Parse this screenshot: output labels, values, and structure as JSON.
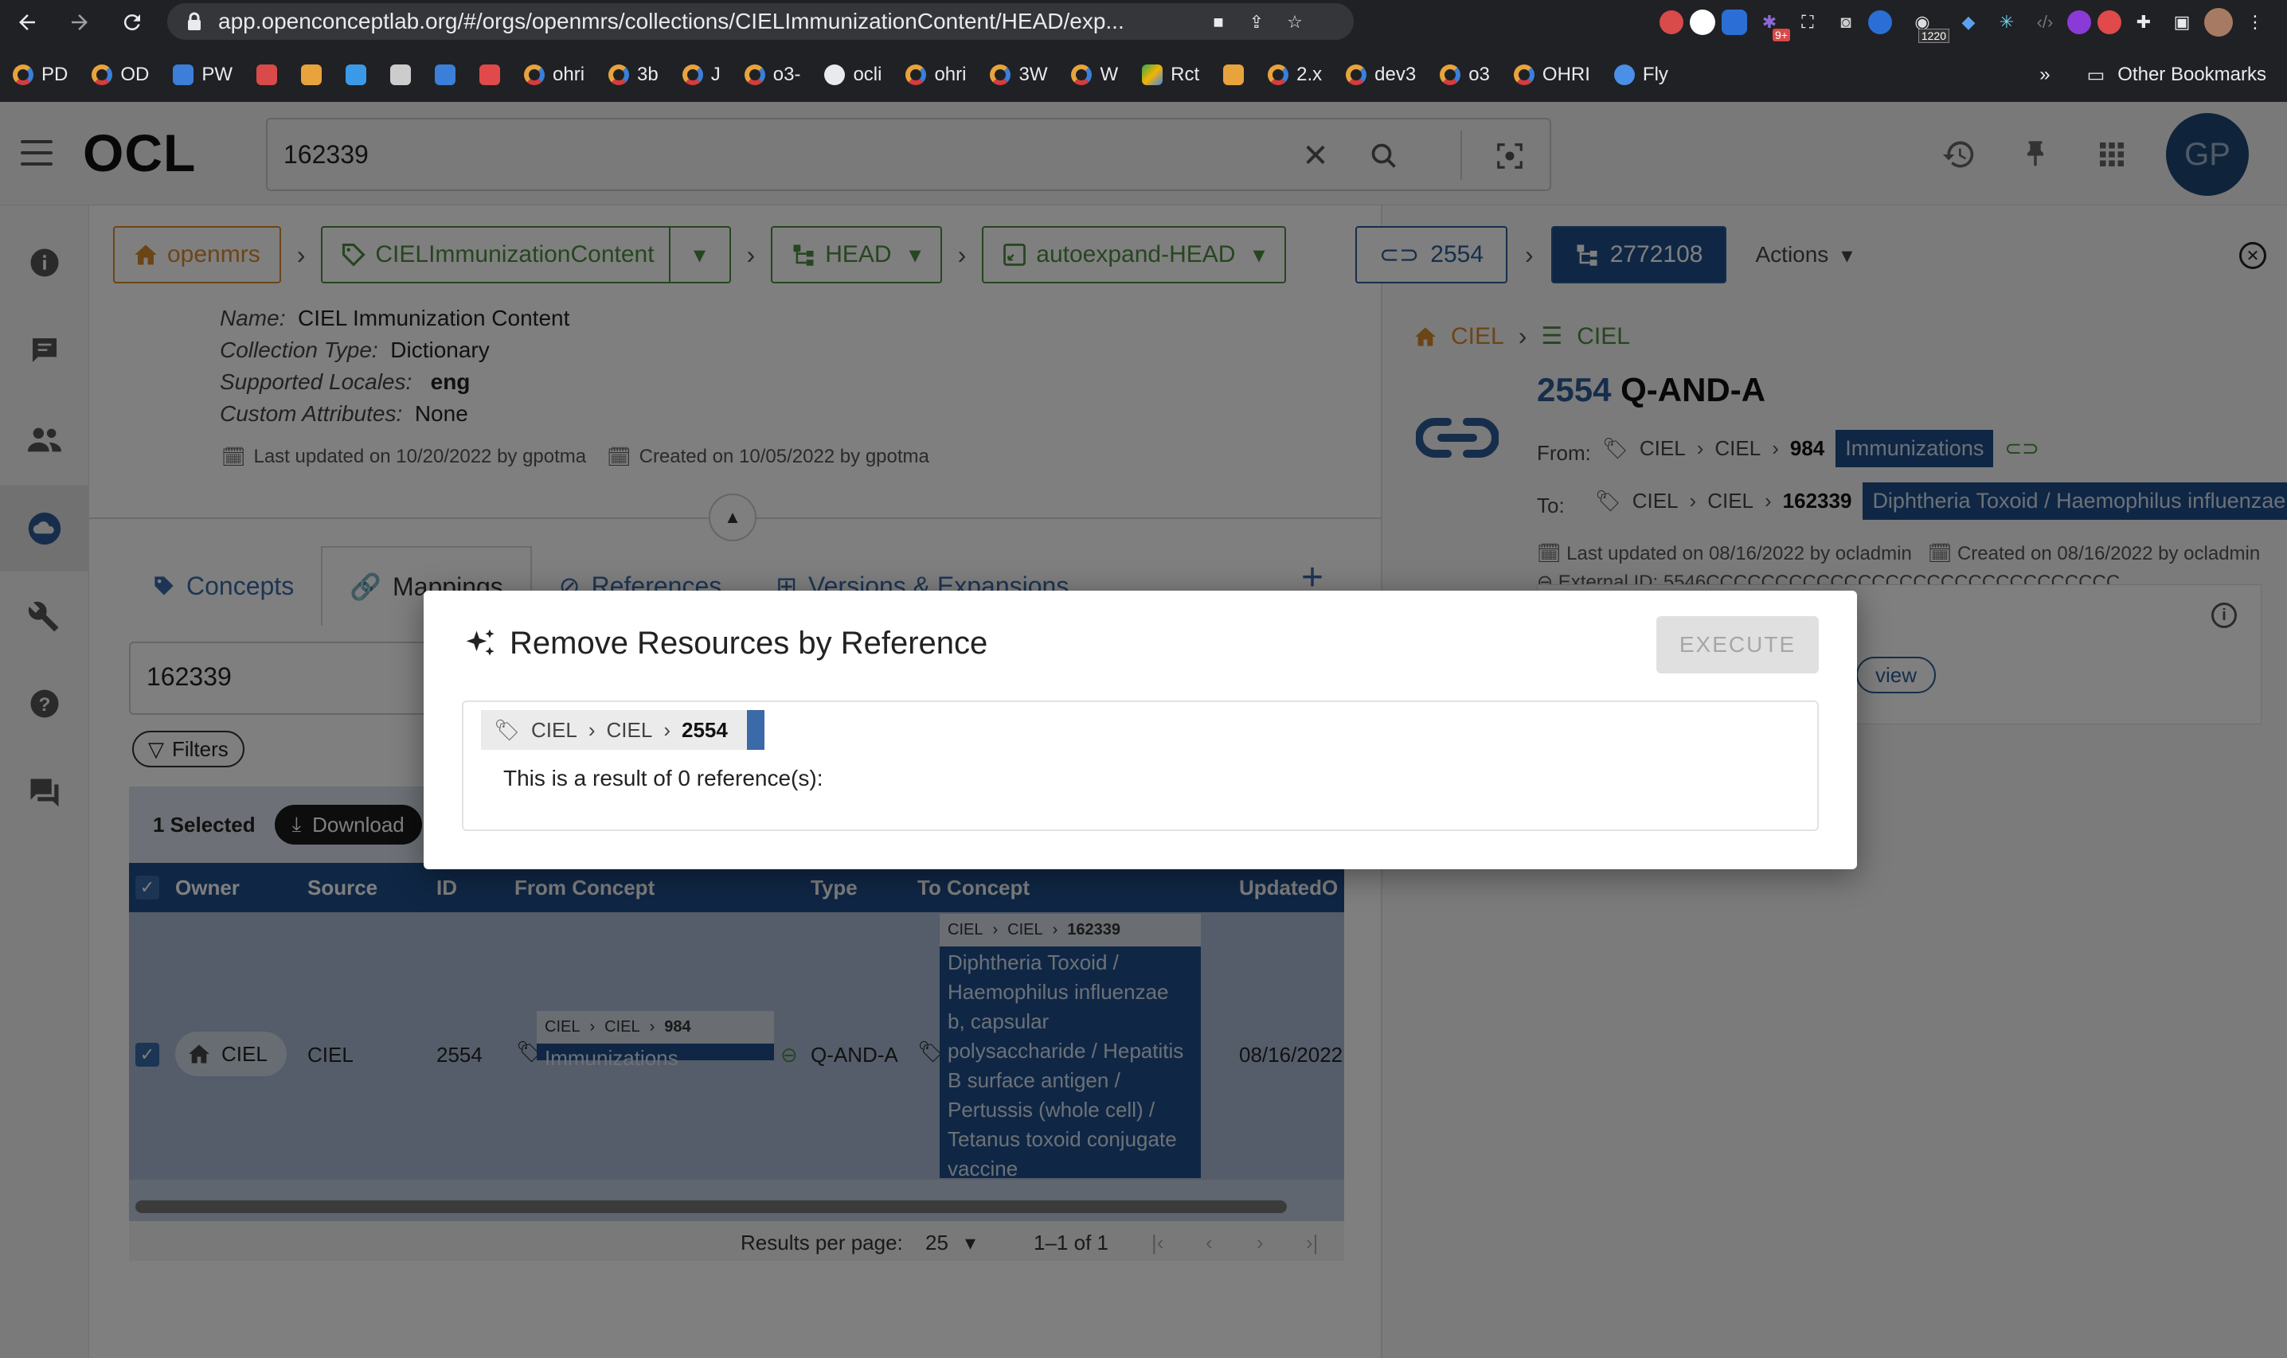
{
  "browser": {
    "url": "app.openconceptlab.org/#/orgs/openmrs/collections/CIELImmunizationContent/HEAD/exp...",
    "badge_count": "9+",
    "badge_number": "1220",
    "bookmarks": [
      "PD",
      "OD",
      "PW",
      "",
      "",
      "",
      "",
      "",
      "",
      "ohri",
      "3b",
      "J",
      "o3-",
      "ocli",
      "ohri",
      "3W",
      "W",
      "Rct",
      "",
      "2.x",
      "dev3",
      "o3",
      "OHRI",
      "Fly"
    ],
    "bookmarks_more": "»",
    "other_bookmarks": "Other Bookmarks"
  },
  "app": {
    "logo": "OCL",
    "search_value": "162339",
    "avatar_initials": "GP"
  },
  "breadcrumbs": {
    "org": "openmrs",
    "collection": "CIELImmunizationContent",
    "version": "HEAD",
    "expansion": "autoexpand-HEAD"
  },
  "collection_meta": {
    "name_label": "Name:",
    "name_value": "CIEL Immunization Content",
    "type_label": "Collection Type:",
    "type_value": "Dictionary",
    "locales_label": "Supported Locales:",
    "locales_value": "eng",
    "attrs_label": "Custom Attributes:",
    "attrs_value": "None",
    "last_updated": "Last updated on 10/20/2022 by gpotma",
    "created": "Created on 10/05/2022 by gpotma"
  },
  "tabs": [
    {
      "label": "Concepts"
    },
    {
      "label": "Mappings"
    },
    {
      "label": "References"
    },
    {
      "label": "Versions & Expansions"
    }
  ],
  "list": {
    "search_value": "162339",
    "filters_label": "Filters",
    "selected_label": "1 Selected",
    "download_label": "Download",
    "columns": [
      "Owner",
      "Source",
      "ID",
      "From Concept",
      "Type",
      "To Concept",
      "UpdatedO"
    ],
    "row": {
      "owner": "CIEL",
      "source": "CIEL",
      "id": "2554",
      "from_crumb": [
        "CIEL",
        "CIEL",
        "984"
      ],
      "from_name": "Immunizations",
      "type": "Q-AND-A",
      "to_crumb": [
        "CIEL",
        "CIEL",
        "162339"
      ],
      "to_name_lines": [
        "Diphtheria Toxoid /",
        "Haemophilus influenzae",
        "b, capsular",
        "polysaccharide / Hepatitis",
        "B surface antigen /",
        "Pertussis (whole cell) /",
        "Tetanus toxoid conjugate",
        "vaccine"
      ],
      "updated": "08/16/2022"
    },
    "pager": {
      "rows_label": "Results per page:",
      "rows_value": "25",
      "range": "1–1 of 1"
    }
  },
  "detail": {
    "mapping_chip": "2554",
    "version_chip": "2772108",
    "actions_label": "Actions",
    "crumb_owner": "CIEL",
    "crumb_source": "CIEL",
    "title_id": "2554",
    "title_type": "Q-AND-A",
    "from_label": "From:",
    "from_crumb": [
      "CIEL",
      "CIEL",
      "984"
    ],
    "from_name": "Immunizations",
    "to_label": "To:",
    "to_crumb": [
      "CIEL",
      "CIEL",
      "162339"
    ],
    "to_name": "Diphtheria Toxoid / Haemophilus influenzae",
    "last_updated": "Last updated on 08/16/2022 by ocladmin",
    "created": "Created on 08/16/2022 by ocladmin",
    "external_id": "External ID: 5546CCCCCCCCCCCCCCCCCCCCCCCCCCCCCC",
    "view_label": "view"
  },
  "dialog": {
    "title": "Remove Resources by Reference",
    "execute_label": "EXECUTE",
    "ref_crumb": [
      "CIEL",
      "CIEL",
      "2554"
    ],
    "result_text": "This is a result of 0 reference(s):"
  },
  "colors": {
    "brand_blue": "#1e4f8a",
    "org_orange": "#d88a2c",
    "green": "#4d8c3f"
  }
}
